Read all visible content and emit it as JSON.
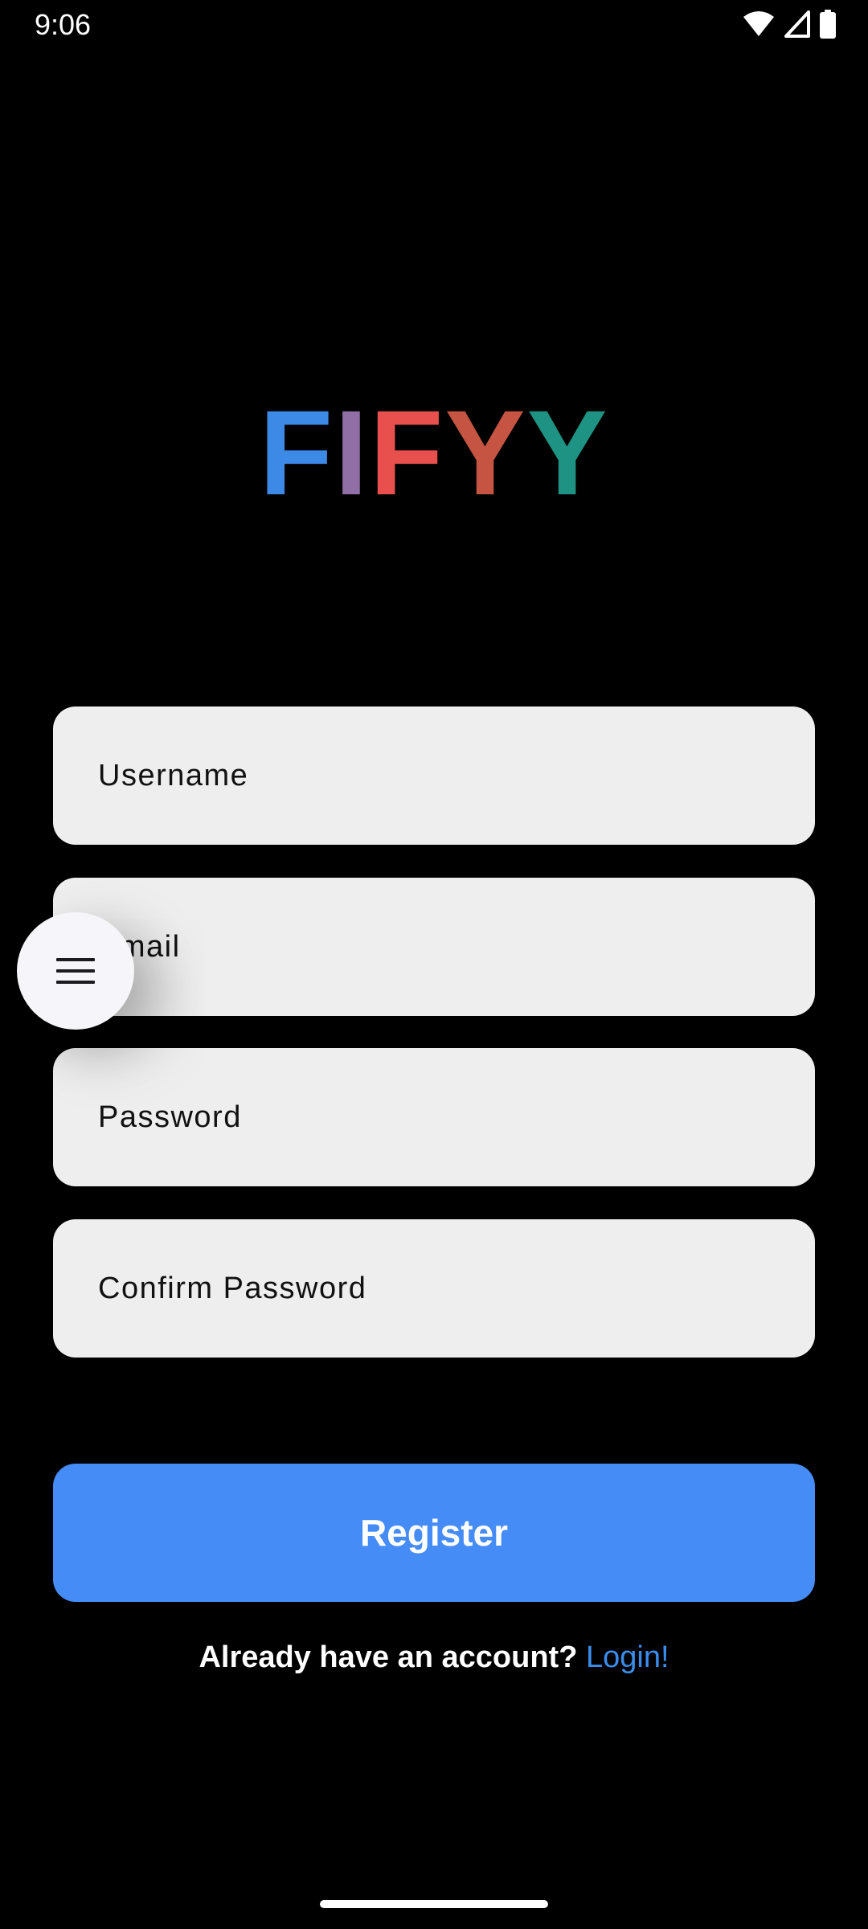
{
  "status_bar": {
    "time": "9:06",
    "icons": [
      "wifi-icon",
      "signal-icon",
      "battery-icon"
    ]
  },
  "logo": {
    "letters": [
      {
        "char": "F",
        "color": "#3d8ae6"
      },
      {
        "char": "I",
        "color": "#8f6fa6"
      },
      {
        "char": "F",
        "color": "#e8504e"
      },
      {
        "char": "Y",
        "color": "#c55443"
      },
      {
        "char": "Y",
        "color": "#1f9383"
      }
    ]
  },
  "form": {
    "username_placeholder": "Username",
    "email_placeholder": "Email",
    "password_placeholder": "Password",
    "confirm_password_placeholder": "Confirm Password"
  },
  "menu_button": {
    "icon": "hamburger-menu-icon"
  },
  "register_label": "Register",
  "login": {
    "prompt": "Already have an account?",
    "link": "Login!"
  },
  "colors": {
    "background": "#000000",
    "field_background": "#eeeeee",
    "accent": "#468cf7",
    "link": "#3b8ded"
  }
}
